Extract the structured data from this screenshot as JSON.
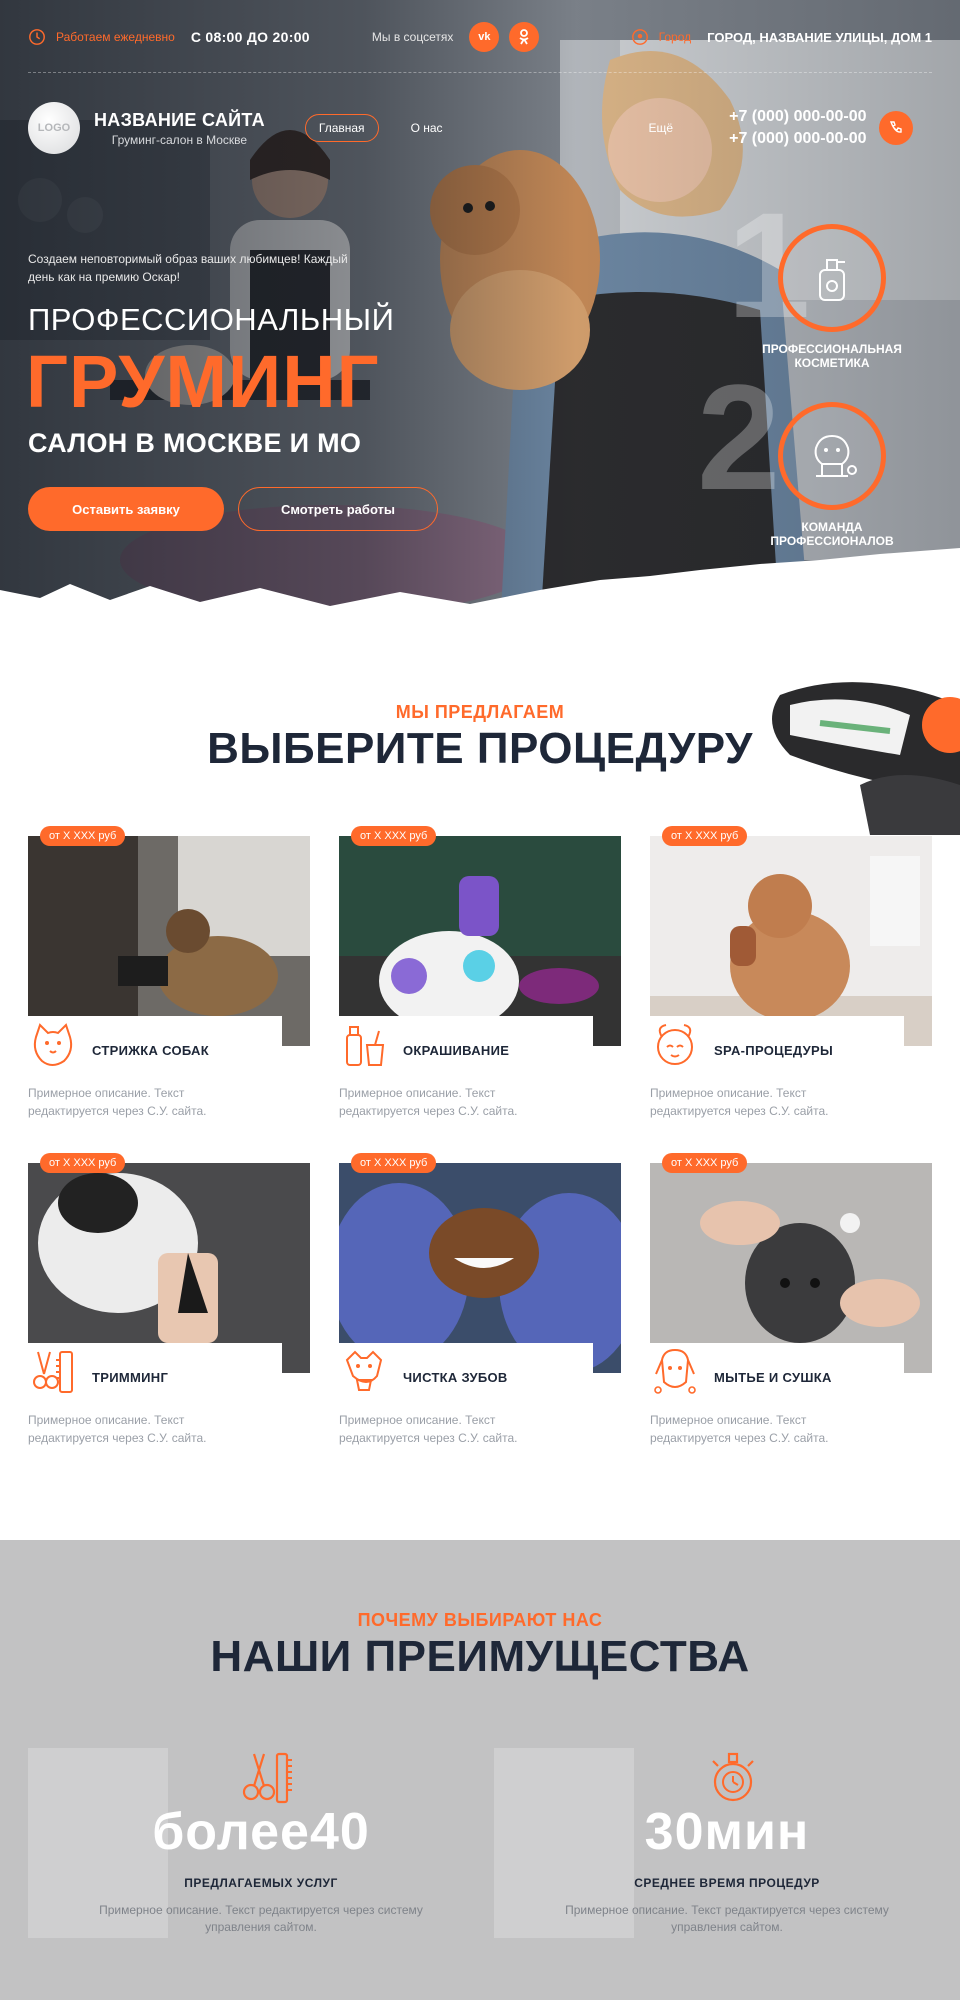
{
  "colors": {
    "accent": "#ff6a2b",
    "dark": "#1e2738",
    "muted": "#9a9fa7",
    "advantages_bg": "#c2c2c3"
  },
  "topbar": {
    "work_label": "Работаем ежедневно",
    "hours": "С 08:00 ДО 20:00",
    "social_label": "Мы в соцсетях",
    "social": [
      {
        "icon": "vk-icon",
        "label": "vk"
      },
      {
        "icon": "ok-icon",
        "label": "ok"
      }
    ],
    "city": "Город",
    "address": "ГОРОД, НАЗВАНИЕ УЛИЦЫ, ДОМ 1"
  },
  "header": {
    "logo_text": "LOGO",
    "site_name": "НАЗВАНИЕ САЙТА",
    "site_subtitle": "Груминг-салон в Москве",
    "nav": {
      "home": "Главная",
      "about": "О нас",
      "more": "Ещё"
    },
    "phones": [
      "+7 (000) 000-00-00",
      "+7 (000) 000-00-00"
    ]
  },
  "hero": {
    "tagline": "Создаем неповторимый образ ваших любимцев! Каждый день как на премию Оскар!",
    "title_line1": "ПРОФЕССИОНАЛЬНЫЙ",
    "title_line2": "ГРУМИНГ",
    "title_line3": "САЛОН В МОСКВЕ И МО",
    "cta_primary": "Оставить заявку",
    "cta_secondary": "Смотреть работы",
    "features": [
      {
        "number": "1",
        "icon": "cosmetics-bottle-icon",
        "label": "ПРОФЕССИОНАЛЬНАЯ КОСМЕТИКА"
      },
      {
        "number": "2",
        "icon": "dog-grooming-icon",
        "label": "КОМАНДА ПРОФЕССИОНАЛОВ"
      }
    ]
  },
  "procedures": {
    "eyebrow": "МЫ ПРЕДЛАГАЕМ",
    "title": "ВЫБЕРИТЕ ПРОЦЕДУРУ",
    "items": [
      {
        "price": "от X XXX руб",
        "icon": "dog-face-icon",
        "title": "СТРИЖКА СОБАК",
        "desc": "Примерное описание. Текст редактируется через С.У. сайта."
      },
      {
        "price": "от X XXX руб",
        "icon": "dye-bottle-icon",
        "title": "ОКРАШИВАНИЕ",
        "desc": "Примерное описание. Текст редактируется через С.У. сайта."
      },
      {
        "price": "от X XXX руб",
        "icon": "spa-dog-icon",
        "title": "SPA-ПРОЦЕДУРЫ",
        "desc": "Примерное описание. Текст редактируется через С.У. сайта."
      },
      {
        "price": "от X XXX руб",
        "icon": "trimmer-tools-icon",
        "title": "ТРИММИНГ",
        "desc": "Примерное описание. Текст редактируется через С.У. сайта."
      },
      {
        "price": "от X XXX руб",
        "icon": "dog-teeth-icon",
        "title": "ЧИСТКА ЗУБОВ",
        "desc": "Примерное описание. Текст редактируется через С.У. сайта."
      },
      {
        "price": "от X XXX руб",
        "icon": "dog-bath-icon",
        "title": "МЫТЬЕ И СУШКА",
        "desc": "Примерное описание. Текст редактируется через С.У. сайта."
      }
    ]
  },
  "advantages": {
    "eyebrow": "ПОЧЕМУ ВЫБИРАЮТ НАС",
    "title": "НАШИ ПРЕИМУЩЕСТВА",
    "items": [
      {
        "icon": "scissors-comb-icon",
        "value": "более40",
        "caption": "ПРЕДЛАГАЕМЫХ УСЛУГ",
        "desc": "Примерное описание. Текст редактируется через систему управления сайтом."
      },
      {
        "icon": "stopwatch-icon",
        "value": "30мин",
        "caption": "СРЕДНЕЕ ВРЕМЯ ПРОЦЕДУР",
        "desc": "Примерное описание. Текст редактируется через систему управления сайтом."
      }
    ]
  }
}
